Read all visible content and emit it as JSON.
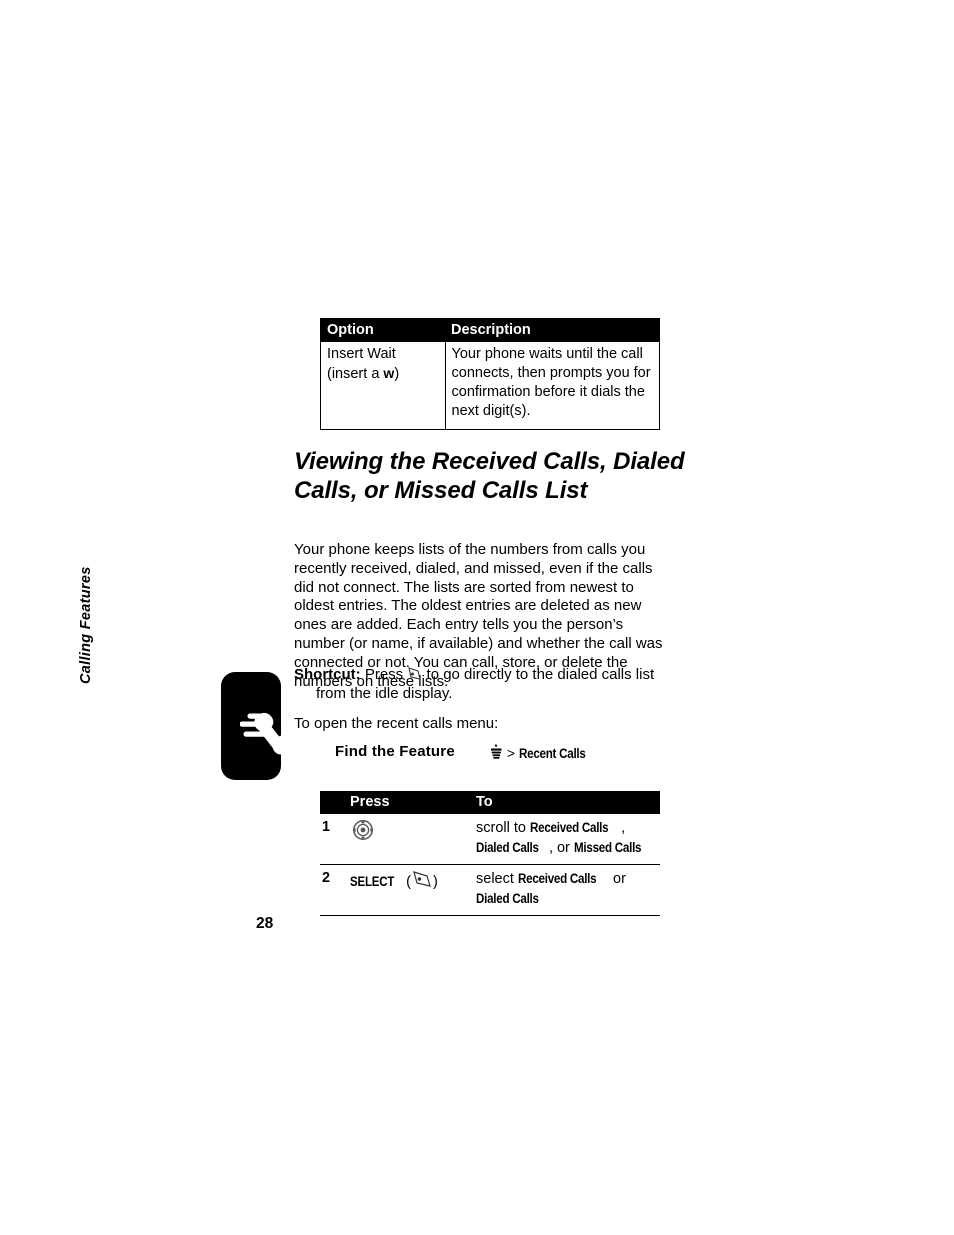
{
  "page": {
    "number": "28",
    "chapter_label": "Calling Features"
  },
  "icons": {
    "side_tab": "phone-handset-icon",
    "shortcut_key": "softkey-icon",
    "menu_key": "menu-icon",
    "nav_key": "navigation-wheel-icon",
    "select_key": "softkey-icon"
  },
  "options_table": {
    "headers": [
      "Option",
      "Description"
    ],
    "rows": [
      {
        "option_line1": "Insert Wait",
        "option_line2_pre": "(insert a ",
        "option_line2_code": "w",
        "option_line2_post": ")",
        "description": "Your phone waits until the call connects, then prompts you for confirmation before it dials the next digit(s)."
      }
    ]
  },
  "heading": "Viewing the Received Calls, Dialed Calls, or Missed Calls List",
  "body_paragraph": "Your phone keeps lists of the numbers from calls you recently received, dialed, and missed, even if the calls did not connect. The lists are sorted from newest to oldest entries. The oldest entries are deleted as new ones are added. Each entry tells you the person’s number (or name, if available) and whether the call was connected or not. You can call, store, or delete the numbers on these lists.",
  "shortcut": {
    "label": "Shortcut:",
    "text_before_icon": " Press ",
    "text_after_icon": " to go directly to the dialed calls list",
    "continuation": "from the idle display."
  },
  "intro_line": "To open the recent calls menu:",
  "find_feature": {
    "label": "Find the Feature",
    "separator": ">",
    "path_item": "Recent Calls"
  },
  "steps_table": {
    "headers": [
      "",
      "Press",
      "To"
    ],
    "rows": [
      {
        "number": "1",
        "press_icon": "navigation-wheel-icon",
        "press_label": "",
        "to_pre": "scroll to ",
        "to_kw1": "Received Calls",
        "to_mid1": ", ",
        "to_kw2": "Dialed Calls",
        "to_mid2": ", or ",
        "to_kw3": "Missed Calls"
      },
      {
        "number": "2",
        "press_icon": "softkey-icon",
        "press_label": "SELECT",
        "to_pre": "select ",
        "to_kw1": "Received Calls",
        "to_mid1": " or ",
        "to_kw2": "Dialed Calls",
        "to_mid2": "",
        "to_kw3": ""
      }
    ]
  }
}
